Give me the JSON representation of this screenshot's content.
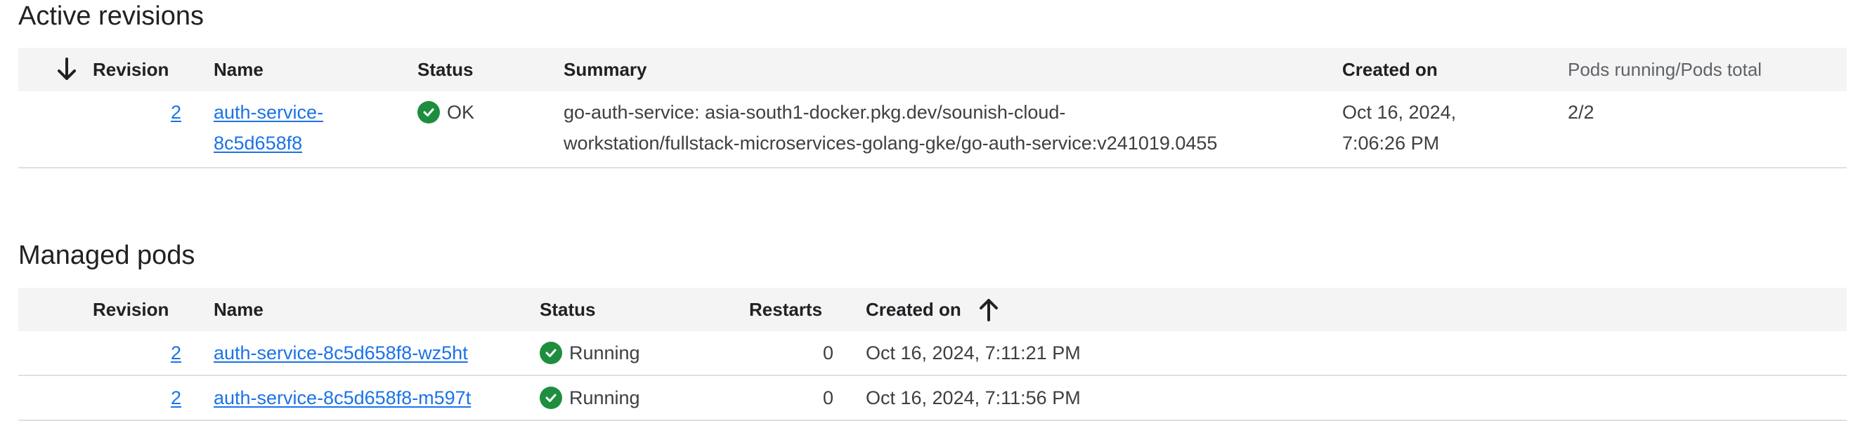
{
  "active_revisions": {
    "title": "Active revisions",
    "columns": {
      "revision": "Revision",
      "name": "Name",
      "status": "Status",
      "summary": "Summary",
      "created_on": "Created on",
      "pods": "Pods running/Pods total"
    },
    "rows": [
      {
        "revision": "2",
        "name_line1": "auth-service-",
        "name_line2": "8c5d658f8",
        "status": "OK",
        "summary_line1": "go-auth-service: asia-south1-docker.pkg.dev/sounish-cloud-",
        "summary_line2": "workstation/fullstack-microservices-golang-gke/go-auth-service:v241019.0455",
        "created_line1": "Oct 16, 2024,",
        "created_line2": "7:06:26 PM",
        "pods": "2/2"
      }
    ]
  },
  "managed_pods": {
    "title": "Managed pods",
    "columns": {
      "revision": "Revision",
      "name": "Name",
      "status": "Status",
      "restarts": "Restarts",
      "created_on": "Created on"
    },
    "rows": [
      {
        "revision": "2",
        "name": "auth-service-8c5d658f8-wz5ht",
        "status": "Running",
        "restarts": "0",
        "created_on": "Oct 16, 2024, 7:11:21 PM"
      },
      {
        "revision": "2",
        "name": "auth-service-8c5d658f8-m597t",
        "status": "Running",
        "restarts": "0",
        "created_on": "Oct 16, 2024, 7:11:56 PM"
      }
    ]
  },
  "colors": {
    "link": "#1a73e8",
    "status_ok": "#1e8e3e",
    "header_bg": "#f4f4f4"
  },
  "icons": {
    "sort_desc": "arrow-down-icon",
    "sort_asc": "arrow-up-icon",
    "status_ok": "check-circle-icon"
  }
}
